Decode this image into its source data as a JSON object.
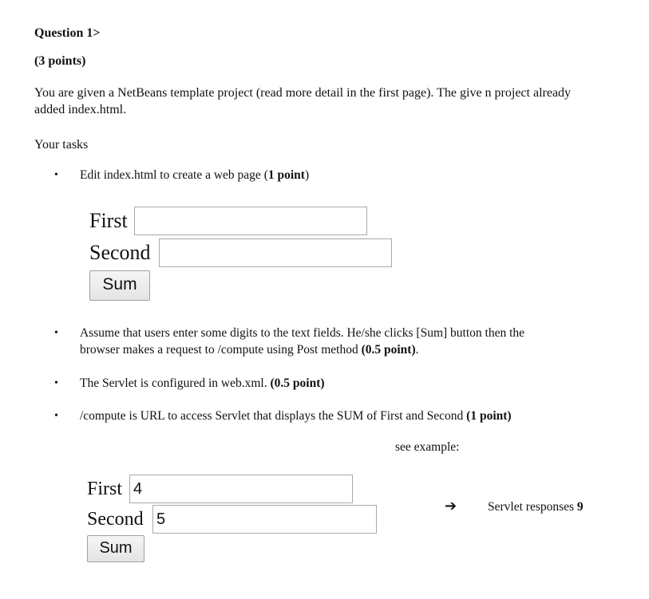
{
  "question": {
    "title": "Question 1>",
    "points": "(3 points)"
  },
  "intro": {
    "line1": "You are given a NetBeans template project (read more detail in the first page). The give  n project already",
    "line2": "added index.html."
  },
  "tasks_label": "Your tasks",
  "bullets": [
    {
      "text": "Edit index.html to create a web page (",
      "bold": "1 point",
      "after": ")"
    },
    {
      "line1": "Assume that users enter some digits to the text fields. He/she clicks [Sum] button then the",
      "line2": "browser makes a request to /compute using Post method ",
      "bold": "(0.5 point)",
      "after": "."
    },
    {
      "text": "The Servlet is configured in web.xml. ",
      "bold": "(0.5 point)",
      "after": ""
    },
    {
      "text": "/compute is URL to access Servlet that displays the SUM of First and Second ",
      "bold": "(1 point)",
      "after": ""
    }
  ],
  "bullet_glyph": "•",
  "form": {
    "first_label": "First",
    "second_label": "Second",
    "first_value": "",
    "second_value": "",
    "button_label": "Sum"
  },
  "example": {
    "caption": "see example:",
    "first_label": "First",
    "second_label": "Second",
    "first_value": "4",
    "second_value": "5",
    "button_label": "Sum",
    "arrow": "➔",
    "response_text": "Servlet responses ",
    "response_value": "9"
  }
}
